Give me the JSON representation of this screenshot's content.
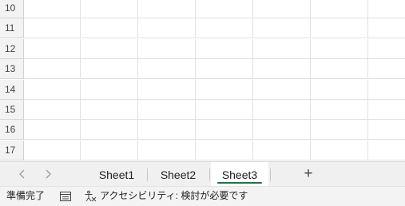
{
  "grid": {
    "row_numbers": [
      "10",
      "11",
      "12",
      "13",
      "14",
      "15",
      "16",
      "17"
    ]
  },
  "sheet_tabs": {
    "scroll_left_icon": "chevron-left-icon",
    "scroll_right_icon": "chevron-right-icon",
    "tabs": [
      {
        "label": "Sheet1",
        "active": false
      },
      {
        "label": "Sheet2",
        "active": false
      },
      {
        "label": "Sheet3",
        "active": true
      }
    ],
    "add_sheet_label": "+"
  },
  "status_bar": {
    "ready_text": "準備完了",
    "mode_icon": "page-layout-icon",
    "accessibility_icon": "accessibility-icon",
    "accessibility_text": "アクセシビリティ: 検討が必要です"
  },
  "colors": {
    "accent": "#217346",
    "header_bg": "#f3f3f3",
    "gridline": "#e1e1e1"
  }
}
